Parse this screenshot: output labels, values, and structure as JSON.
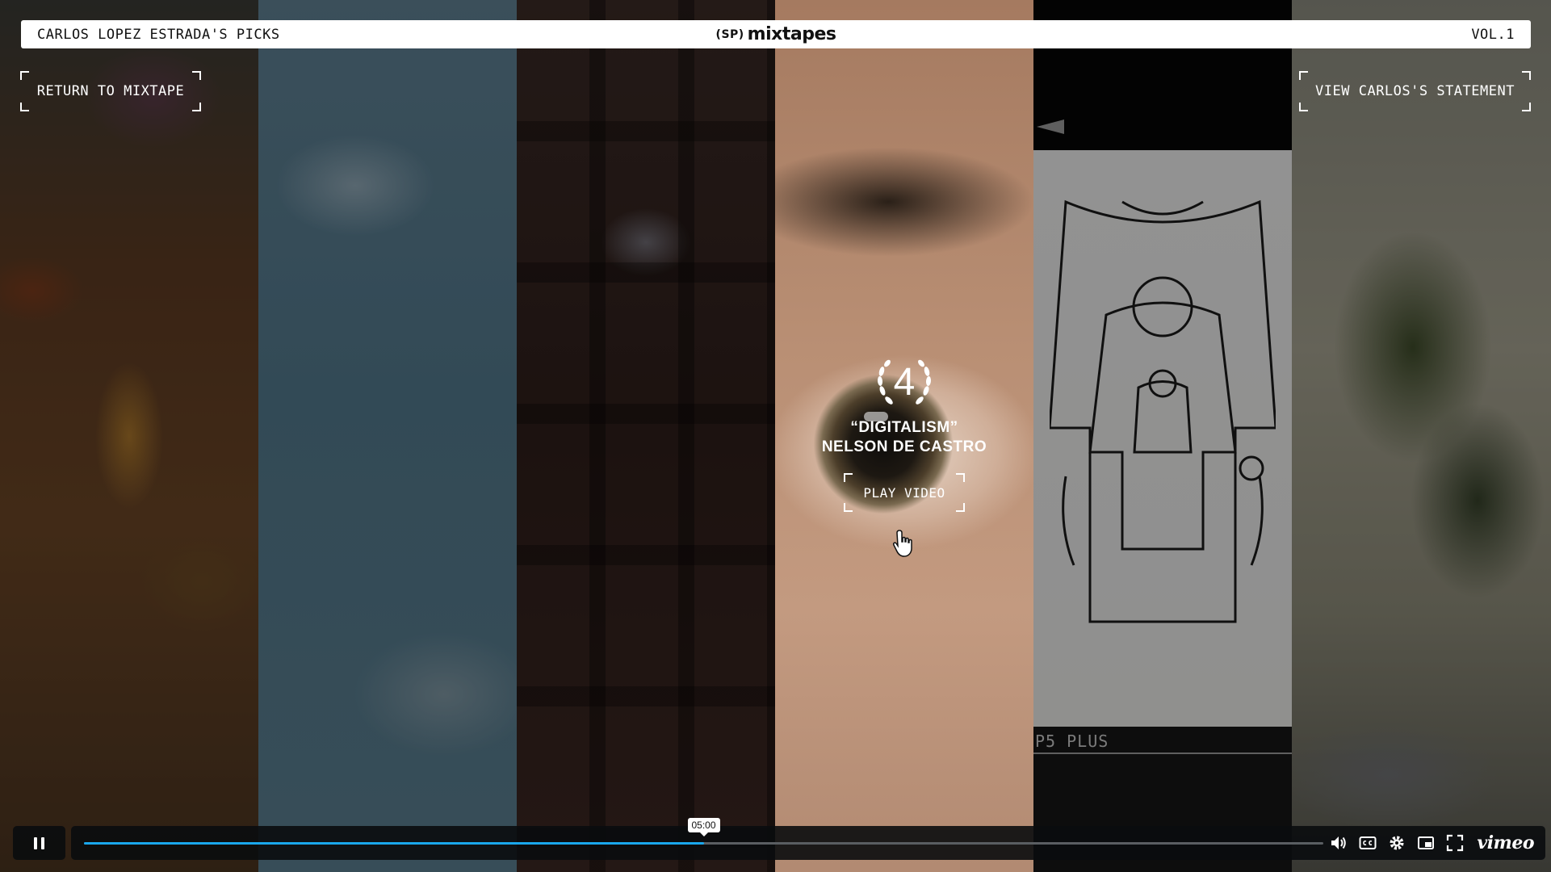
{
  "header": {
    "curator_label": "CARLOS LOPEZ ESTRADA'S PICKS",
    "brand_mark": "(SP)",
    "brand_name": "mixtapes",
    "volume_label": "VOL.1"
  },
  "nav": {
    "return_label": "RETURN TO MIXTAPE",
    "statement_label": "VIEW CARLOS'S STATEMENT"
  },
  "feature": {
    "rank": "4",
    "title": "“DIGITALISM”",
    "director": "NELSON DE CASTRO",
    "play_label": "PLAY VIDEO"
  },
  "background_panels": [
    {
      "name": "floral-still"
    },
    {
      "name": "sky-still"
    },
    {
      "name": "building-still"
    },
    {
      "name": "eye-still",
      "active": true
    },
    {
      "name": "drawing-still",
      "caption": "P5 PLUS"
    },
    {
      "name": "tree-still"
    }
  ],
  "player": {
    "state": "playing",
    "current_time": "05:00",
    "progress": 0.5,
    "accent_color": "#1aa7ec",
    "icons": [
      "pause-icon",
      "volume-icon",
      "closed-captions-icon",
      "settings-icon",
      "picture-in-picture-icon",
      "fullscreen-icon"
    ],
    "logo_text": "vimeo"
  },
  "colors": {
    "topbar_bg": "#ffffff",
    "text_on_dark": "#ffffff",
    "control_bg": "#0a0c0e"
  }
}
